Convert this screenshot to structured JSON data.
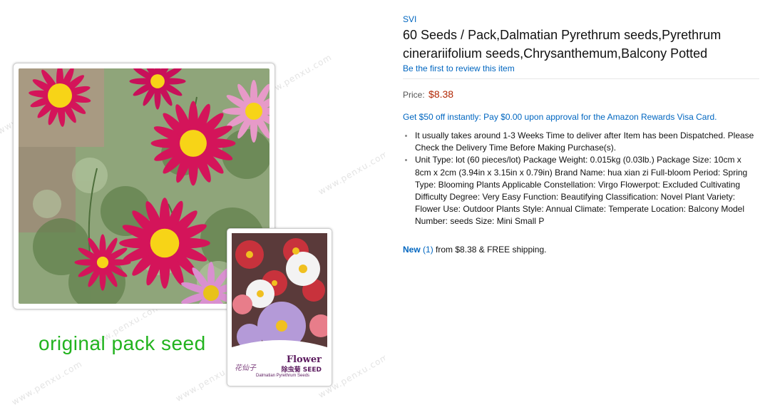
{
  "product": {
    "brand": "SVI",
    "title": "60 Seeds / Pack,Dalmatian Pyrethrum seeds,Pyrethrum cinerariifolium seeds,Chrysanthemum,Balcony Potted",
    "review_link": "Be the first to review this item",
    "price_label": "Price:",
    "price": "$8.38",
    "promo": "Get $50 off instantly: Pay $0.00 upon approval for the Amazon Rewards Visa Card.",
    "bullets": [
      "It usually takes around 1-3 Weeks Time to deliver after Item has been Dispatched. Please Check the Delivery Time Before Making Purchase(s).",
      "Unit Type: lot (60 pieces/lot) Package Weight: 0.015kg (0.03lb.) Package Size: 10cm x 8cm x 2cm (3.94in x 3.15in x 0.79in) Brand Name: hua xian zi Full-bloom Period: Spring Type: Blooming Plants Applicable Constellation: Virgo Flowerpot: Excluded Cultivating Difficulty Degree: Very Easy Function: Beautifying Classification: Novel Plant Variety: Flower Use: Outdoor Plants Style: Annual Climate: Temperate Location: Balcony Model Number: seeds Size: Mini Small P"
    ],
    "offers": {
      "condition": "New",
      "count": "(1)",
      "from_text": "from $8.38",
      "shipping": "& FREE shipping."
    }
  },
  "image": {
    "caption": "original pack seed",
    "watermark": "www.penxu.com",
    "pack": {
      "logo": "花仙子",
      "title": "Flower",
      "chinese": "除虫菊 SEED",
      "latin": "Dalmatian Pyrethrum Seeds"
    }
  },
  "colors": {
    "link": "#0066c0",
    "price": "#b12704",
    "caption": "#22b31e",
    "petal_magenta": "#d4145a",
    "flower_center": "#f7d417",
    "foliage": "#6f8f5a"
  }
}
